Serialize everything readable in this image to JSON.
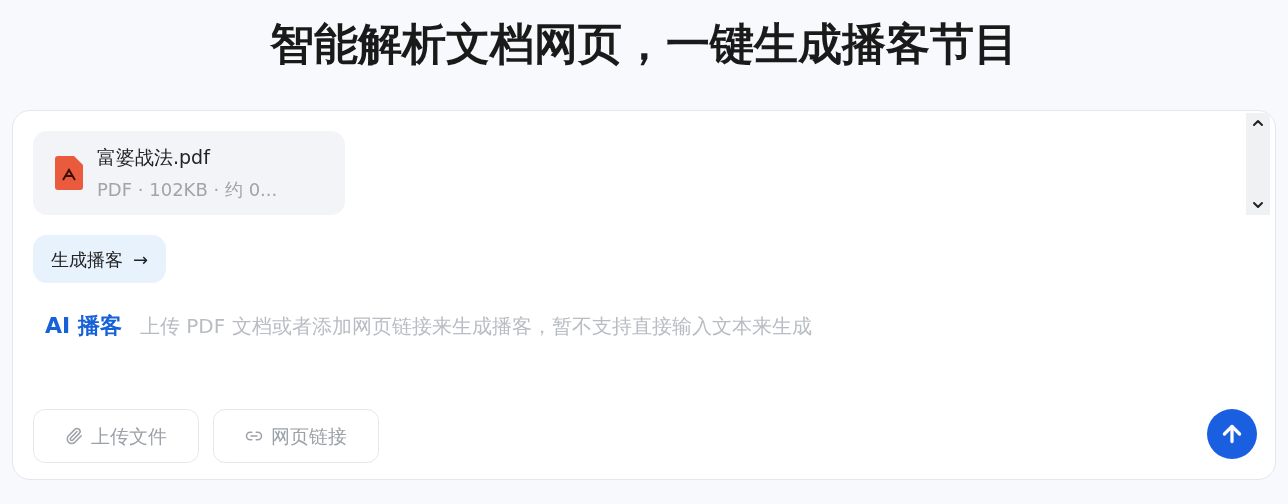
{
  "heading": "智能解析文档网页，一键生成播客节目",
  "attachment": {
    "name": "富婆战法.pdf",
    "meta": "PDF · 102KB · 约 0..."
  },
  "generate_button": {
    "label": "生成播客",
    "arrow": "→"
  },
  "prompt": {
    "badge": "AI 播客",
    "placeholder": "上传 PDF 文档或者添加网页链接来生成播客，暂不支持直接输入文本来生成"
  },
  "actions": [
    {
      "kind": "upload",
      "label": "上传文件",
      "disabled": true
    },
    {
      "kind": "link",
      "label": "网页链接",
      "disabled": true
    }
  ]
}
